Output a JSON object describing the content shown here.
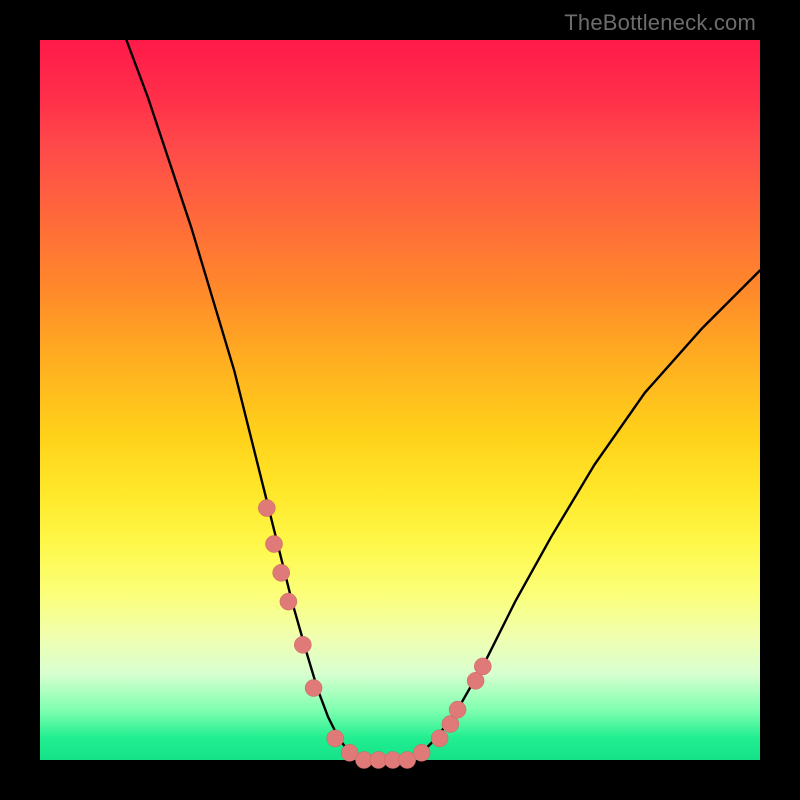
{
  "attribution": "TheBottleneck.com",
  "chart_data": {
    "type": "line",
    "title": "",
    "xlabel": "",
    "ylabel": "",
    "xlim": [
      0,
      100
    ],
    "ylim": [
      0,
      100
    ],
    "grid": false,
    "legend": false,
    "background_gradient": {
      "direction": "vertical",
      "top": "#ff1a4a",
      "middle": "#ffd21a",
      "bottom": "#15e288"
    },
    "series": [
      {
        "name": "bottleneck-curve",
        "color": "#000000",
        "x": [
          12,
          15,
          18,
          21,
          24,
          27,
          29,
          31,
          33,
          35,
          37,
          38.5,
          40,
          41.5,
          43,
          45,
          47,
          50,
          53,
          55,
          58,
          62,
          66,
          71,
          77,
          84,
          92,
          100
        ],
        "y": [
          100,
          92,
          83,
          74,
          64,
          54,
          46,
          38,
          30,
          22,
          15,
          10,
          6,
          3,
          1,
          0,
          0,
          0,
          1,
          3,
          7,
          14,
          22,
          31,
          41,
          51,
          60,
          68
        ]
      }
    ],
    "highlighted_points": {
      "name": "sample-dots",
      "color": "#e07a78",
      "x": [
        31.5,
        32.5,
        33.5,
        34.5,
        36.5,
        38.0,
        41.0,
        43.0,
        45.0,
        47.0,
        49.0,
        51.0,
        53.0,
        55.5,
        57.0,
        58.0,
        60.5,
        61.5
      ],
      "y": [
        35,
        30,
        26,
        22,
        16,
        10,
        3,
        1,
        0,
        0,
        0,
        0,
        1,
        3,
        5,
        7,
        11,
        13
      ]
    }
  }
}
